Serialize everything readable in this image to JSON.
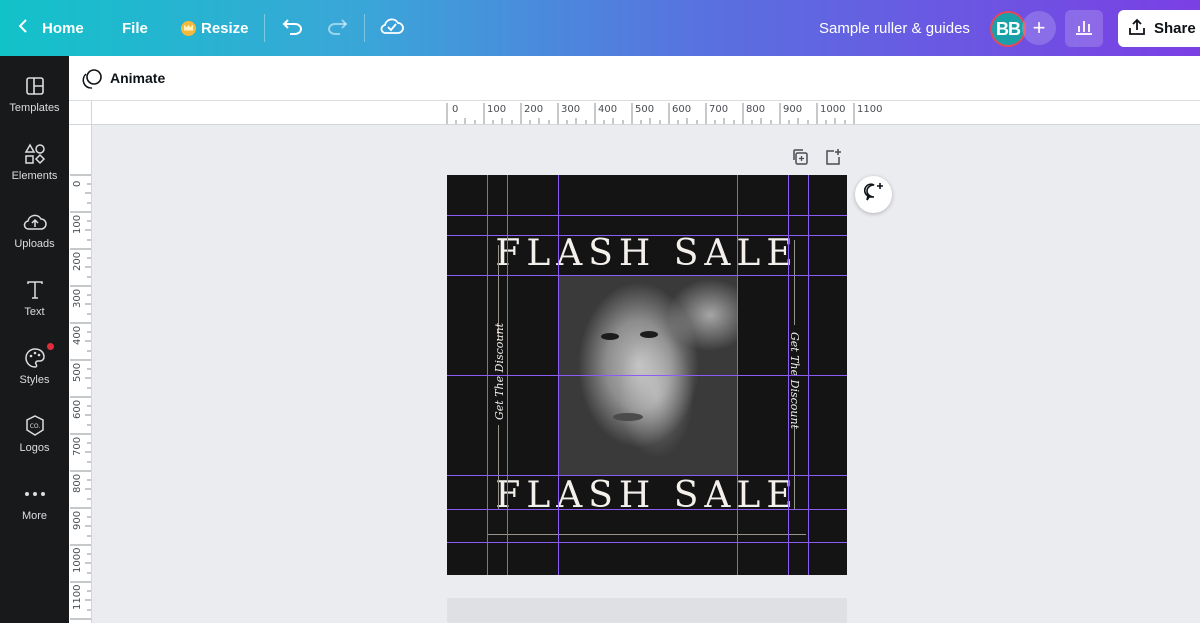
{
  "topbar": {
    "home_label": "Home",
    "file_label": "File",
    "resize_label": "Resize",
    "design_title": "Sample ruller & guides",
    "avatar_initials": "BB",
    "share_label": "Share"
  },
  "sidebar": {
    "items": [
      {
        "label": "Templates",
        "icon": "templates-icon"
      },
      {
        "label": "Elements",
        "icon": "elements-icon"
      },
      {
        "label": "Uploads",
        "icon": "uploads-icon"
      },
      {
        "label": "Text",
        "icon": "text-icon"
      },
      {
        "label": "Styles",
        "icon": "styles-icon"
      },
      {
        "label": "Logos",
        "icon": "logos-icon"
      },
      {
        "label": "More",
        "icon": "more-icon"
      }
    ]
  },
  "animate": {
    "label": "Animate"
  },
  "ruler": {
    "top_ticks": [
      "0",
      "100",
      "200",
      "300",
      "400",
      "500",
      "600",
      "700",
      "800",
      "900",
      "1000",
      "1100"
    ],
    "left_ticks": [
      "0",
      "100",
      "200",
      "300",
      "400",
      "500",
      "600",
      "700",
      "800",
      "900",
      "1000",
      "1100"
    ]
  },
  "design": {
    "headline_top": "FLASH SALE",
    "headline_bottom": "FLASH SALE",
    "side_text_left": "Get The Discount",
    "side_text_right": "Get The Discount"
  },
  "colors": {
    "guide": "#8b5cf6",
    "design_bg": "#151414",
    "sidebar_bg": "#18191b"
  }
}
